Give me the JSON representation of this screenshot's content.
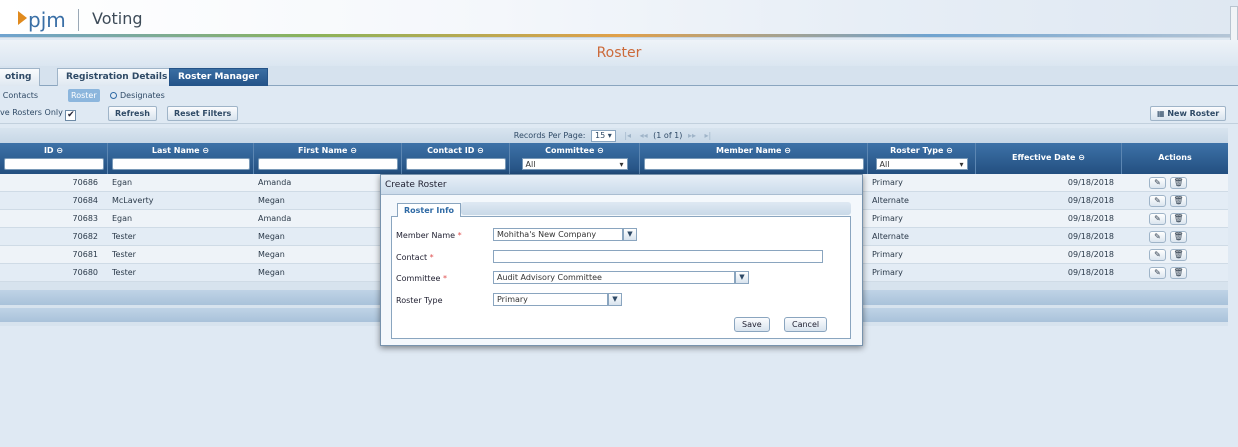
{
  "app": {
    "logo": "pjm",
    "name": "Voting"
  },
  "page_title": "Roster",
  "tabs": [
    {
      "label": "oting",
      "active": false
    },
    {
      "label": "Registration Details",
      "active": false
    },
    {
      "label": "Roster Manager",
      "active": true
    }
  ],
  "subtabs": {
    "contacts": "l Contacts",
    "roster": "Roster",
    "designates": "Designates"
  },
  "toolbar": {
    "active_only_label": "ve Rosters Only",
    "active_only_checked": true,
    "refresh": "Refresh",
    "reset_filters": "Reset Filters",
    "new_roster": "New Roster"
  },
  "pager": {
    "label": "Records Per Page:",
    "per_page": "15",
    "info": "(1 of 1)"
  },
  "columns": {
    "id": "ID",
    "last_name": "Last Name",
    "first_name": "First Name",
    "contact_id": "Contact ID",
    "committee": "Committee",
    "member_name": "Member Name",
    "roster_type": "Roster Type",
    "effective_date": "Effective Date",
    "actions": "Actions"
  },
  "filters": {
    "committee": "All",
    "roster_type": "All"
  },
  "rows": [
    {
      "id": "70686",
      "last": "Egan",
      "first": "Amanda",
      "type": "Primary",
      "date": "09/18/2018"
    },
    {
      "id": "70684",
      "last": "McLaverty",
      "first": "Megan",
      "type": "Alternate",
      "date": "09/18/2018"
    },
    {
      "id": "70683",
      "last": "Egan",
      "first": "Amanda",
      "type": "Primary",
      "date": "09/18/2018"
    },
    {
      "id": "70682",
      "last": "Tester",
      "first": "Megan",
      "type": "Alternate",
      "date": "09/18/2018"
    },
    {
      "id": "70681",
      "last": "Tester",
      "first": "Megan",
      "type": "Primary",
      "date": "09/18/2018"
    },
    {
      "id": "70680",
      "last": "Tester",
      "first": "Megan",
      "type": "Primary",
      "date": "09/18/2018"
    }
  ],
  "modal": {
    "title": "Create Roster",
    "tab": "Roster Info",
    "member_name_label": "Member Name",
    "member_name_value": "Mohitha's New Company",
    "contact_label": "Contact",
    "contact_value": "",
    "committee_label": "Committee",
    "committee_value": "Audit Advisory Committee",
    "roster_type_label": "Roster Type",
    "roster_type_value": "Primary",
    "save": "Save",
    "cancel": "Cancel"
  },
  "colors": {
    "header_blue": "#2f5f93",
    "accent_orange": "#cc6a3a",
    "active_tab": "#2f5f93"
  }
}
